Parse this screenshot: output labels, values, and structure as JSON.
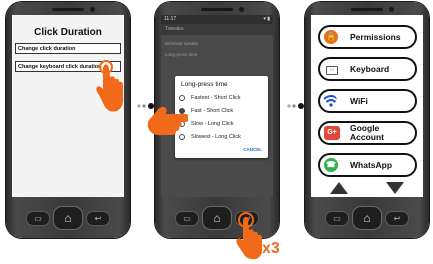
{
  "phone1": {
    "title": "Click Duration",
    "options": [
      "Change click duration",
      "Change keyboard click duration"
    ]
  },
  "phone2": {
    "status_time": "11:17",
    "status_right": "▾ ▮",
    "appbar_title": "Tweaks",
    "bg_lines": [
      "Behavior tweaks",
      "Long-press time"
    ],
    "dialog": {
      "title": "Long-press time",
      "options": [
        "Fastest - Short Click",
        "Fast - Short Click",
        "Slow - Long Click",
        "Slowest - Long Click"
      ],
      "selected_index": 1,
      "cancel": "CANCEL"
    },
    "tap_count": "x3"
  },
  "phone3": {
    "buttons": [
      {
        "label": "Permissions",
        "icon": "lock-icon",
        "color": "#e8701a"
      },
      {
        "label": "Keyboard",
        "icon": "keyboard-icon",
        "color": "#555555"
      },
      {
        "label": "WiFi",
        "icon": "wifi-icon",
        "color": "#1a4fd6"
      },
      {
        "label": "Google Account",
        "icon": "google-plus-icon",
        "color": "#e0483c"
      },
      {
        "label": "WhatsApp",
        "icon": "whatsapp-icon",
        "color": "#2fb24c"
      }
    ]
  }
}
